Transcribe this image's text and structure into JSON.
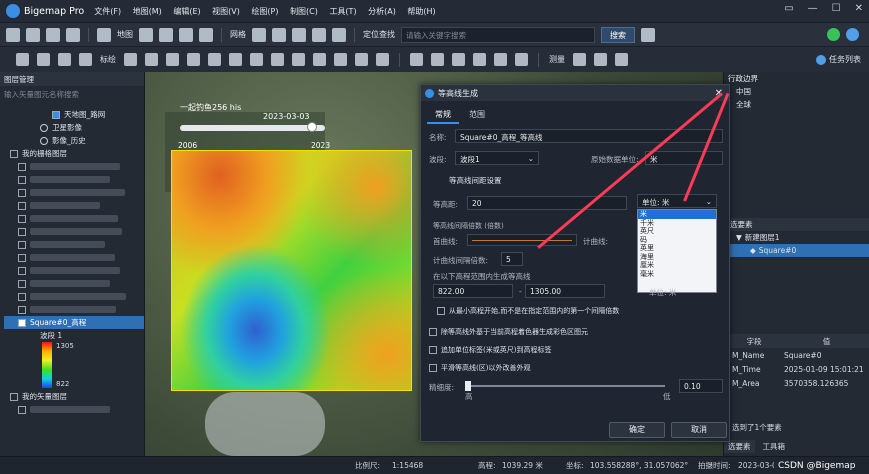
{
  "app": {
    "title": "Bigemap Pro"
  },
  "menu": [
    "文件(F)",
    "地图(M)",
    "编辑(E)",
    "视图(V)",
    "绘图(P)",
    "制图(C)",
    "工具(T)",
    "分析(A)",
    "帮助(H)"
  ],
  "toolbar": {
    "map_label": "地图",
    "grid_label": "网格",
    "locate_label": "定位查找",
    "search_placeholder": "请输入关键字搜索",
    "search_button": "搜索",
    "measure_label": "测量",
    "task_label": "任务列表",
    "mark_label": "标绘"
  },
  "left_panel": {
    "title": "图层管理",
    "search_placeholder": "输入矢量图元名称搜索",
    "items": [
      {
        "label": "天地图_路网"
      },
      {
        "label": "卫星影像"
      },
      {
        "label": "影像_历史"
      },
      {
        "label": "我的栅格图层"
      },
      {
        "label": "Square#0_高程"
      },
      {
        "label": "波段 1"
      },
      {
        "label": "1305"
      },
      {
        "label": "822"
      },
      {
        "label": "我的矢量图层"
      }
    ]
  },
  "map": {
    "timeline_title": "一起钓鱼256 his",
    "timeline_date": "2023-03-03",
    "timeline_start": "2006",
    "timeline_end": "2023"
  },
  "dialog": {
    "title": "等高线生成",
    "tabs": [
      "常规",
      "范围"
    ],
    "name_label": "名称:",
    "name_value": "Square#0_高程_等高线",
    "band_label": "波段:",
    "band_value": "波段1",
    "unit_label": "原始数据单位:",
    "unit_value": "米",
    "section_interval": "等高线间距设置",
    "interval_label": "等高距:",
    "interval_value": "20",
    "unit_select": "单位: 米",
    "section_interval_param": "等高线间隔倍数 (倍数)",
    "primary_label": "首曲线:",
    "count_label": "计曲线:",
    "count_multiple_label": "计曲线间隔倍数:",
    "count_multiple_value": "5",
    "range_label": "在以下高程范围内生成等高线",
    "range_min": "822.00",
    "range_max": "1305.00",
    "range_unit": "单位: 米",
    "opt1": "从最小高程开始,而不是在指定范围内的第一个间隔倍数",
    "opt2": "除等高线外基于当前高程着色器生成彩色区图元",
    "opt3": "追加单位标签(米或英尺)到高程标签",
    "opt4": "平滑等高线(区)以外改善外观",
    "smooth_label": "精细度:",
    "smooth_high": "高",
    "smooth_low": "低",
    "smooth_value": "0.10",
    "ok": "确定",
    "cancel": "取消",
    "units": [
      "米",
      "千米",
      "英尺",
      "码",
      "英里",
      "海里",
      "厘米",
      "毫米"
    ]
  },
  "right_panel": {
    "title": "行政边界",
    "country": "中国",
    "world": "全球",
    "selection_title": "选要素",
    "new_layer": "新建图层1",
    "selected_item": "Square#0",
    "headers": [
      "字段",
      "值"
    ],
    "rows": [
      {
        "field": "M_Name",
        "value": "Square#0"
      },
      {
        "field": "M_Time",
        "value": "2025-01-09 15:01:21"
      },
      {
        "field": "M_Area",
        "value": "3570358.126365"
      }
    ],
    "selected_count": "选到了1个要素",
    "tab1": "选要素",
    "tab2": "工具箱"
  },
  "status": {
    "scale_label": "比例尺:",
    "scale_value": "1:15468",
    "elev_label": "高程:",
    "elev_value": "1039.29 米",
    "coord_label": "坐标:",
    "coord_value": "103.558288°, 31.057062°",
    "date_label": "拍摄时间:",
    "date_value": "2023-03-03",
    "watermark": "CSDN @Bigemap"
  }
}
